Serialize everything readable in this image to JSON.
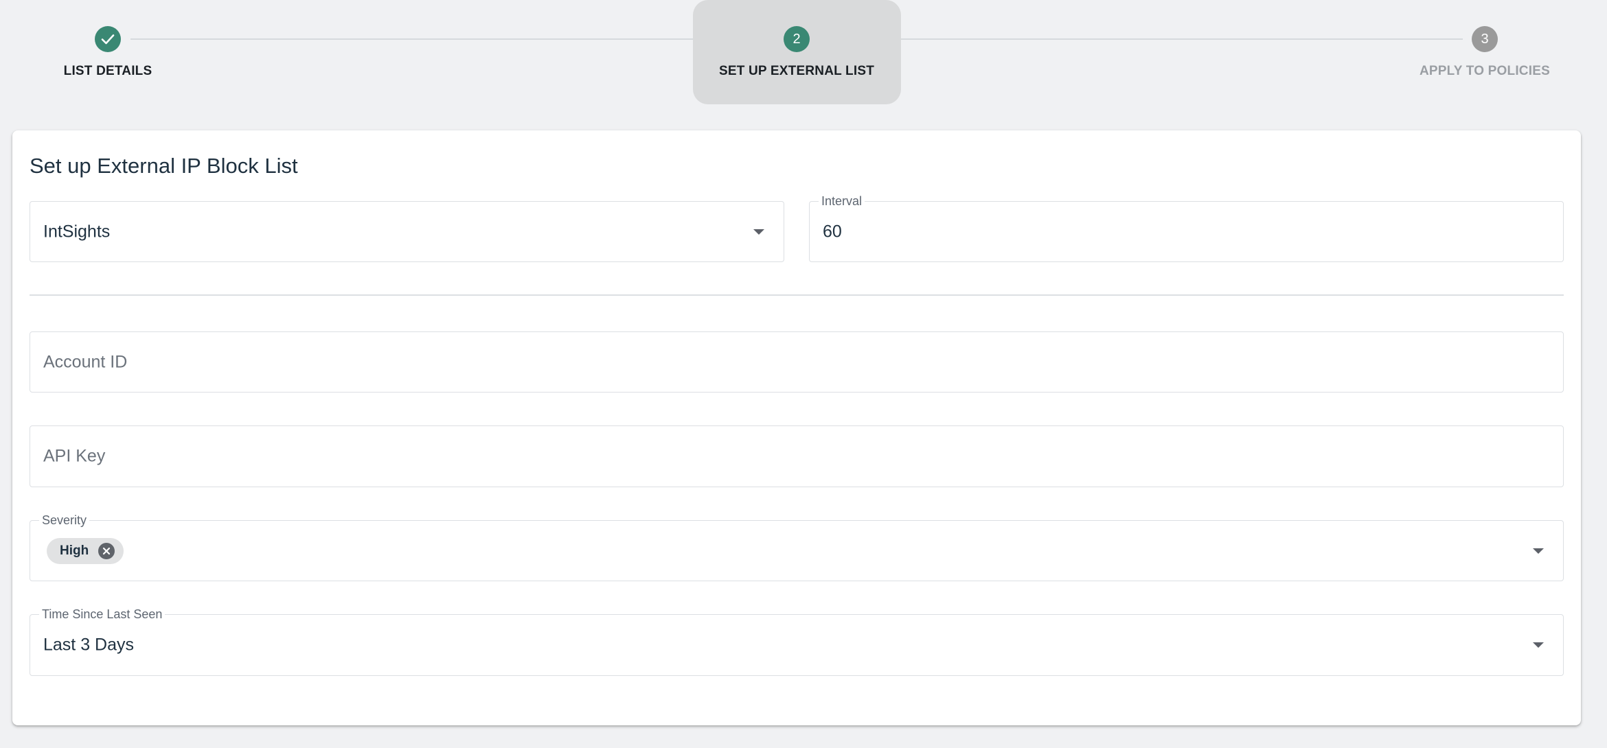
{
  "stepper": {
    "steps": [
      {
        "number": "1",
        "label": "LIST DETAILS",
        "state": "done"
      },
      {
        "number": "2",
        "label": "SET UP EXTERNAL LIST",
        "state": "active"
      },
      {
        "number": "3",
        "label": "APPLY TO POLICIES",
        "state": "pending"
      }
    ]
  },
  "card": {
    "title": "Set up External IP Block List",
    "source": {
      "value": "IntSights",
      "icon": "chevron-down-icon"
    },
    "interval": {
      "label": "Interval",
      "value": "60"
    },
    "account_id": {
      "placeholder": "Account ID"
    },
    "api_key": {
      "placeholder": "API Key"
    },
    "severity": {
      "label": "Severity",
      "chips": [
        {
          "label": "High",
          "icon": "cancel-circle-icon"
        }
      ]
    },
    "time_since_last_seen": {
      "label": "Time Since Last Seen",
      "value": "Last 3 Days"
    }
  },
  "colors": {
    "accent": "#3a8873",
    "pending": "#9a9a9a",
    "page_bg": "#f0f1f3"
  }
}
